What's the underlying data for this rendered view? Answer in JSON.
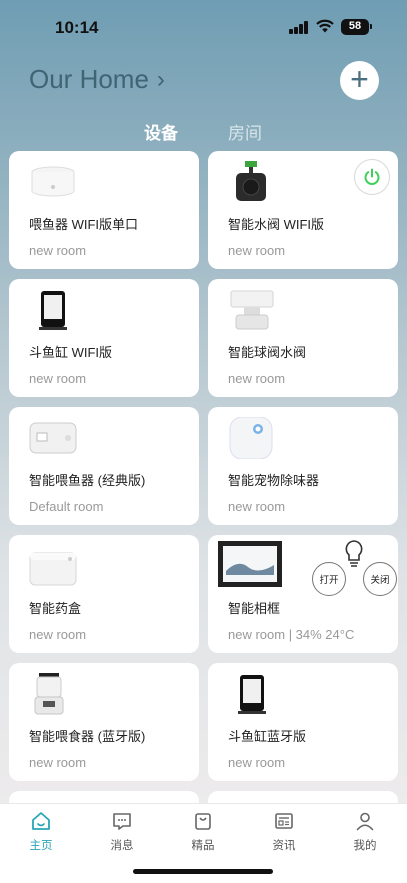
{
  "status": {
    "time": "10:14",
    "battery": "58"
  },
  "header": {
    "title": "Our Home",
    "chevron": "›",
    "add_icon": "plus-icon"
  },
  "tabs": [
    {
      "label": "设备",
      "active": true
    },
    {
      "label": "房间",
      "active": false
    }
  ],
  "devices": [
    {
      "name": "喂鱼器 WIFI版单口",
      "room": "new room"
    },
    {
      "name": "智能水阀 WIFI版",
      "room": "new room",
      "power": "on"
    },
    {
      "name": "斗鱼缸 WIFI版",
      "room": "new room"
    },
    {
      "name": "智能球阀水阀",
      "room": "new room"
    },
    {
      "name": "智能喂鱼器 (经典版)",
      "room": "Default room"
    },
    {
      "name": "智能宠物除味器",
      "room": "new room"
    },
    {
      "name": "智能药盒",
      "room": "new room"
    },
    {
      "name": "智能相框",
      "room": "new room | 34% 24°C",
      "buttons": {
        "open": "打开",
        "close": "关闭"
      }
    },
    {
      "name": "智能喂食器 (蓝牙版)",
      "room": "new room"
    },
    {
      "name": "斗鱼缸蓝牙版",
      "room": "new room"
    }
  ],
  "tabbar": [
    {
      "label": "主页",
      "icon": "home-icon",
      "active": true
    },
    {
      "label": "消息",
      "icon": "message-icon",
      "active": false
    },
    {
      "label": "精品",
      "icon": "shopping-bag-icon",
      "active": false
    },
    {
      "label": "资讯",
      "icon": "news-icon",
      "active": false
    },
    {
      "label": "我的",
      "icon": "profile-icon",
      "active": false
    }
  ],
  "colors": {
    "accent": "#2aa6b8",
    "power_on": "#3ecf5a",
    "title": "#3f6474"
  }
}
